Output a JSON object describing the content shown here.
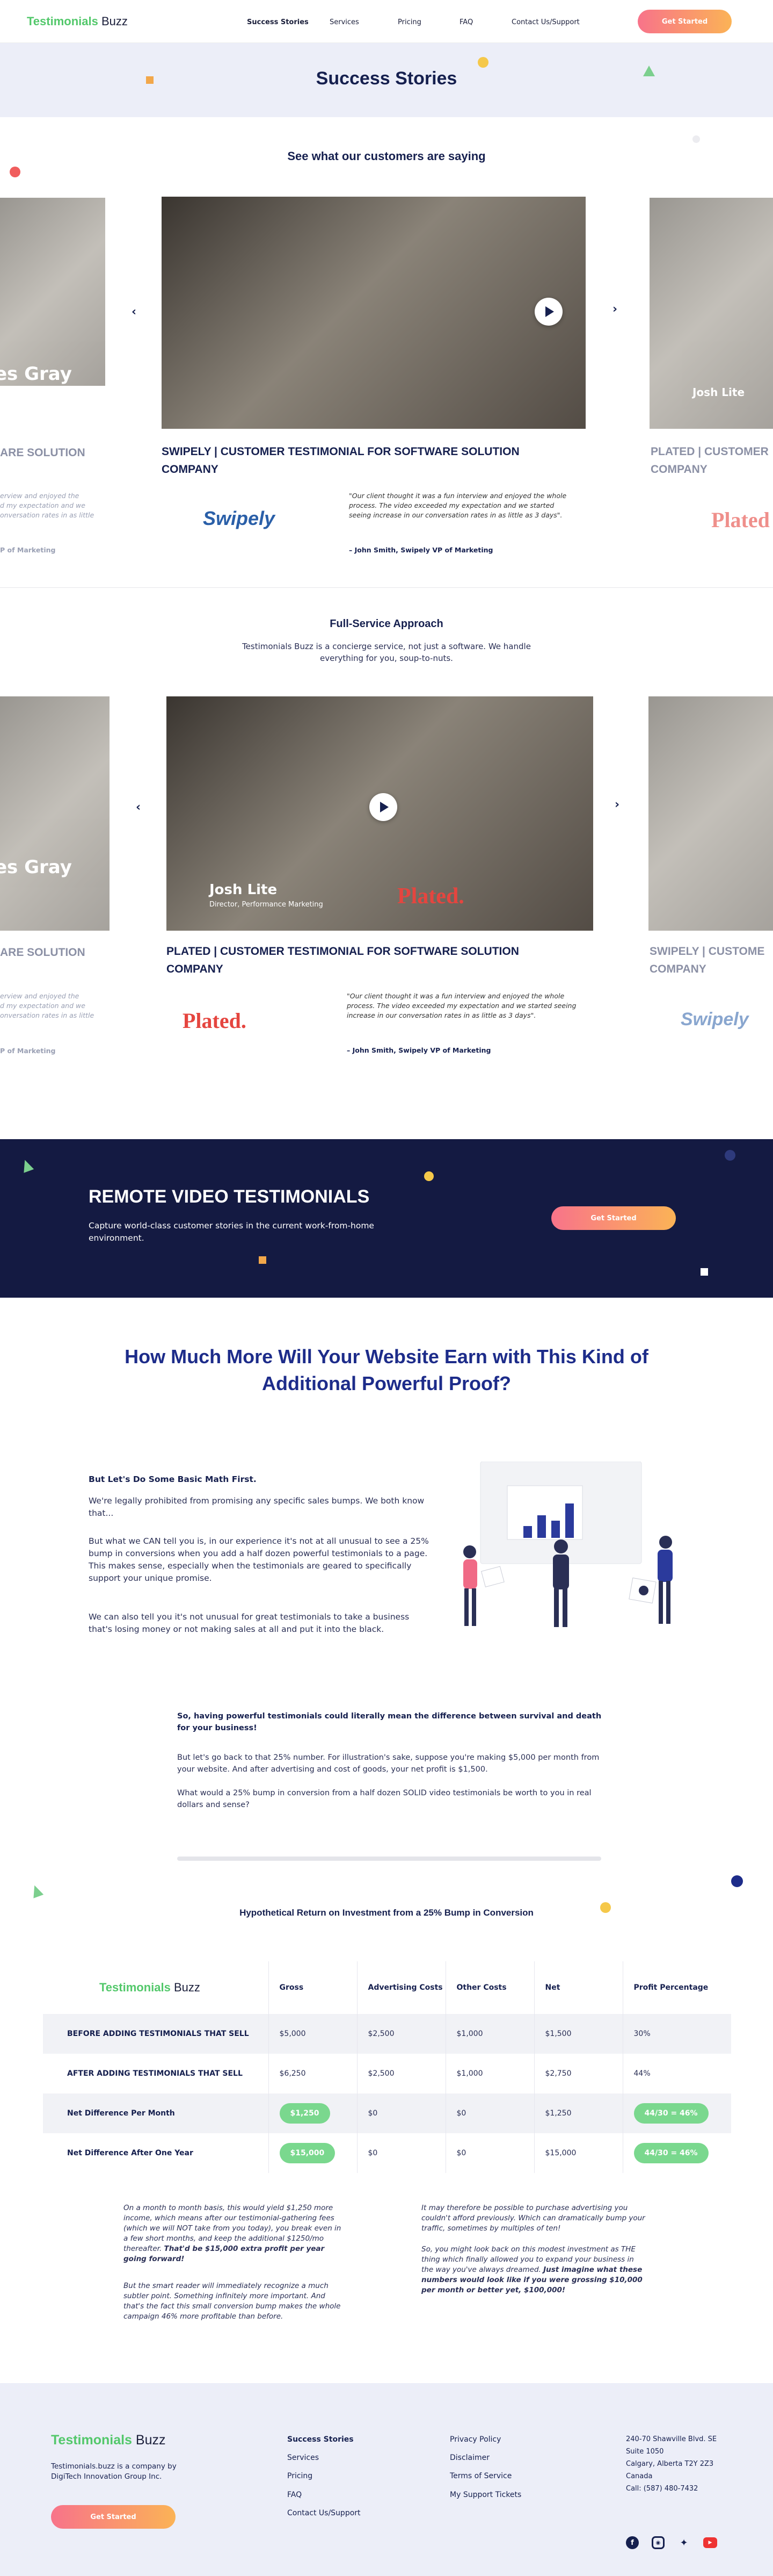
{
  "header": {
    "logo_primary": "Testimonials",
    "logo_secondary": "Buzz",
    "nav": [
      "Success Stories",
      "Services",
      "Pricing",
      "FAQ",
      "Contact Us/Support"
    ],
    "cta": "Get Started"
  },
  "hero": {
    "title": "Success Stories"
  },
  "testimonials": {
    "heading": "See what our customers are saying",
    "card1": {
      "title": "SWIPELY | CUSTOMER TESTIMONIAL FOR SOFTWARE SOLUTION COMPANY",
      "brand": "Swipely",
      "quote": "\"Our client thought it was a fun interview and enjoyed the whole process. The video exceeded my expectation and we started seeing increase in our conversation rates in as little as 3 days\".",
      "author": "– John Smith, Swipely VP of Marketing",
      "left_peek_name": "es Gray",
      "left_peek_title": "ARE SOLUTION",
      "left_peek_quote": "erview and enjoyed the\nd my expectation and we\nonversation rates in as little",
      "left_peek_author": "P of Marketing",
      "right_peek_name": "Josh Lite",
      "right_peek_title": "PLATED | CUSTOMER\nCOMPANY",
      "right_peek_brand": "Plated"
    },
    "card2": {
      "title": "PLATED | CUSTOMER TESTIMONIAL FOR SOFTWARE SOLUTION COMPANY",
      "brand": "Plated.",
      "video_name": "Josh Lite",
      "video_role": "Director, Performance Marketing",
      "video_brand": "Plated.",
      "quote": "\"Our client thought it was a fun interview and enjoyed the whole process. The video exceeded my expectation and we started seeing increase in our conversation rates in as little as 3 days\".",
      "author": "– John Smith, Swipely VP of Marketing",
      "right_peek_title": "SWIPELY | CUSTOME\nCOMPANY",
      "right_peek_brand": "Swipely"
    }
  },
  "full_service": {
    "heading": "Full-Service Approach",
    "body": "Testimonials Buzz is a concierge service, not just a software. We handle everything for you, soup-to-nuts."
  },
  "remote": {
    "title": "REMOTE VIDEO TESTIMONIALS",
    "body": "Capture world-class customer stories in the current work-from-home environment.",
    "cta": "Get Started"
  },
  "earn": {
    "heading": "How Much More Will Your Website Earn with This Kind of Additional Powerful Proof?",
    "lead": "But Let's Do Some Basic Math First.",
    "p1": "We're legally prohibited from promising any specific sales bumps. We both know that...",
    "p2": "But what we CAN tell you is, in our experience it's not at all unusual to see a 25% bump in conversions when you add a half dozen powerful testimonials to a page.  This makes sense, especially when the testimonials are geared to specifically support your unique promise.",
    "p3": "We can also tell you it's not unusual for great testimonials to take a business that's losing money or not making sales at all and put it into the black.",
    "p4": "So, having powerful testimonials could literally mean the difference between survival and death for your business!",
    "p5": "But let's go back to that 25% number. For illustration's sake, suppose you're making $5,000 per month from your website.  And after advertising and cost of goods, your net profit is $1,500.",
    "p6": "What would a 25% bump in conversion from a half dozen SOLID video testimonials be worth to you in real dollars and sense?"
  },
  "table": {
    "title": "Hypothetical Return on Investment from a 25% Bump in Conversion",
    "logo_primary": "Testimonials",
    "logo_secondary": "Buzz",
    "headers": [
      "Gross",
      "Advertising Costs",
      "Other Costs",
      "Net",
      "Profit Percentage"
    ],
    "rows": [
      {
        "label": "BEFORE ADDING TESTIMONIALS THAT SELL",
        "gross": "$5,000",
        "ads": "$2,500",
        "other": "$1,000",
        "net": "$1,500",
        "pct": "30%"
      },
      {
        "label": "AFTER ADDING TESTIMONIALS THAT SELL",
        "gross": "$6,250",
        "ads": "$2,500",
        "other": "$1,000",
        "net": "$2,750",
        "pct": "44%"
      },
      {
        "label": "Net Difference Per Month",
        "gross": "$1,250",
        "ads": "$0",
        "other": "$0",
        "net": "$1,250",
        "pct": "44/30 = 46%"
      },
      {
        "label": "Net Difference After One Year",
        "gross": "$15,000",
        "ads": "$0",
        "other": "$0",
        "net": "$15,000",
        "pct": "44/30 = 46%"
      }
    ]
  },
  "notes": {
    "left1": "On a month to month basis, this would yield $1,250 more income, which means after our testimonial-gathering fees (which we will NOT take from you today), you break even in a few short months, and keep the additional $1250/mo thereafter. ",
    "left1_bold": "That'd be $15,000 extra profit per year going forward!",
    "left2": "But the smart reader will immediately recognize a much subtler point. Something infinitely more important. And that's the fact this small conversion bump makes the whole campaign 46% more profitable than before.",
    "right1": "It may therefore be possible to purchase advertising you couldn't afford previously. Which can dramatically bump your traffic, sometimes by multiples of ten!",
    "right2": "So, you might look back on this modest investment as THE thing which finally allowed you to expand your business in the way you've always dreamed. ",
    "right2_bold": "Just imagine what these numbers would look like if you were grossing $10,000 per month or better yet, $100,000!"
  },
  "footer": {
    "logo_primary": "Testimonials",
    "logo_secondary": "Buzz",
    "company": "Testimonials.buzz is a company by DigiTech Innovation Group Inc.",
    "cta": "Get Started",
    "links1": [
      "Success Stories",
      "Services",
      "Pricing",
      "FAQ",
      "Contact Us/Support"
    ],
    "links2": [
      "Privacy Policy",
      "Disclaimer",
      "Terms of Service",
      "My Support Tickets"
    ],
    "address": [
      "240-70 Shawville Blvd. SE",
      "Suite 1050",
      "Calgary, Alberta T2Y 2Z3",
      "Canada",
      "Call: (587) 480-7432"
    ],
    "social_icons": [
      "facebook-icon",
      "instagram-icon",
      "twitter-icon",
      "youtube-icon"
    ]
  }
}
